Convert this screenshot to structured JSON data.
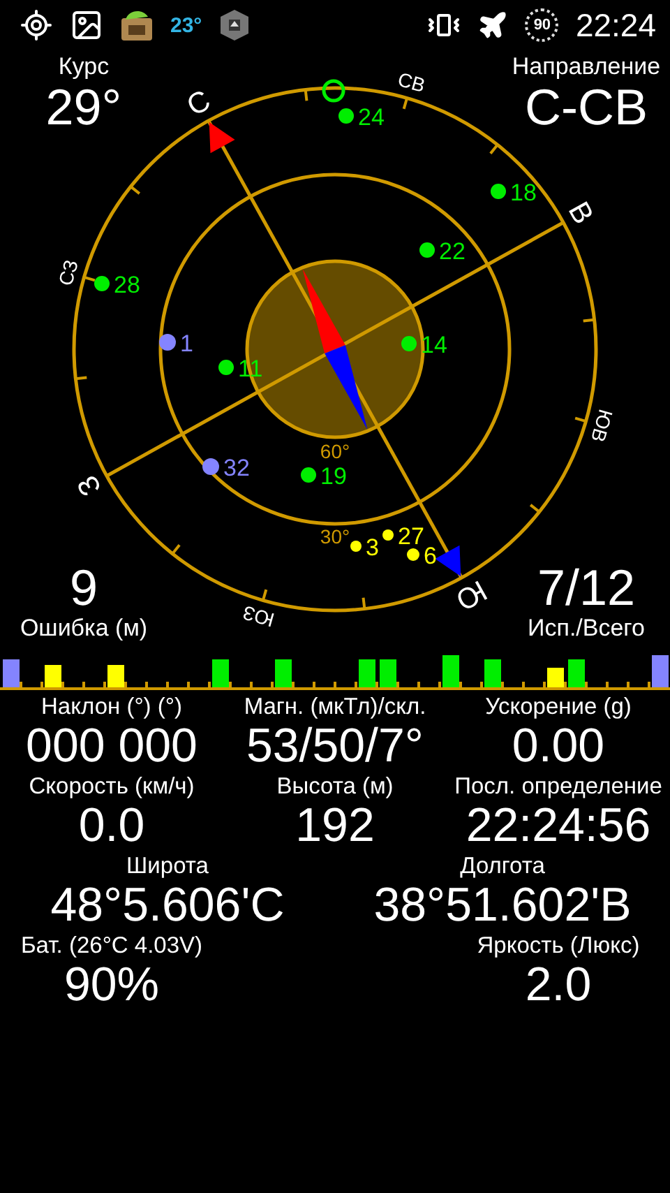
{
  "status_bar": {
    "weather_temp": "23°",
    "badge": "90",
    "time": "22:24"
  },
  "header": {
    "course_label": "Курс",
    "course_value": "29°",
    "direction_label": "Направление",
    "direction_value": "С-СВ"
  },
  "radar": {
    "compass_labels": [
      "С",
      "СВ",
      "В",
      "ЮВ",
      "Ю",
      "ЮЗ",
      "З",
      "СЗ"
    ],
    "elevation_labels": [
      "60°",
      "30°"
    ],
    "satellites": [
      {
        "label": "24",
        "color": "#00ee00"
      },
      {
        "label": "18",
        "color": "#00ee00"
      },
      {
        "label": "22",
        "color": "#00ee00"
      },
      {
        "label": "28",
        "color": "#00ee00"
      },
      {
        "label": "1",
        "color": "#8484ff"
      },
      {
        "label": "14",
        "color": "#00ee00"
      },
      {
        "label": "11",
        "color": "#00ee00"
      },
      {
        "label": "32",
        "color": "#8484ff"
      },
      {
        "label": "19",
        "color": "#00ee00"
      },
      {
        "label": "27",
        "color": "#ffff00"
      },
      {
        "label": "3",
        "color": "#ffff00"
      },
      {
        "label": "6",
        "color": "#ffff00"
      }
    ]
  },
  "accuracy": {
    "value": "9",
    "label": "Ошибка (м)"
  },
  "satellite_count": {
    "value": "7/12",
    "label": "Исп./Всего"
  },
  "signal_bars": [
    {
      "color": "#8484ff"
    },
    {
      "color": "#ffff00"
    },
    {
      "color": "#ffff00"
    },
    {
      "color": "#00ee00"
    },
    {
      "color": "#00ee00"
    },
    {
      "color": "#00ee00"
    },
    {
      "color": "#00ee00"
    },
    {
      "color": "#00ee00"
    },
    {
      "color": "#00ee00"
    },
    {
      "color": "#ffff00"
    },
    {
      "color": "#00ee00"
    },
    {
      "color": "#8484ff"
    }
  ],
  "readings": [
    {
      "kind": "thirds",
      "cells": [
        {
          "label": "Наклон (°) (°)",
          "value": "000 000"
        },
        {
          "label": "Магн. (мкТл)/скл.",
          "value": "53/50/7°"
        },
        {
          "label": "Ускорение (g)",
          "value": "0.00"
        }
      ]
    },
    {
      "kind": "thirds",
      "cells": [
        {
          "label": "Скорость (км/ч)",
          "value": "0.0"
        },
        {
          "label": "Высота (м)",
          "value": "192"
        },
        {
          "label": "Посл. определение",
          "value": "22:24:56"
        }
      ]
    },
    {
      "kind": "halves",
      "cells": [
        {
          "label": "Широта",
          "value": "48°5.606'С"
        },
        {
          "label": "Долгота",
          "value": "38°51.602'В"
        }
      ]
    },
    {
      "kind": "edges",
      "cells": [
        {
          "label": "Бат. (26°C 4.03V)",
          "value": "90%"
        },
        {
          "label": "Яркость (Люкс)",
          "value": "2.0"
        }
      ]
    }
  ]
}
